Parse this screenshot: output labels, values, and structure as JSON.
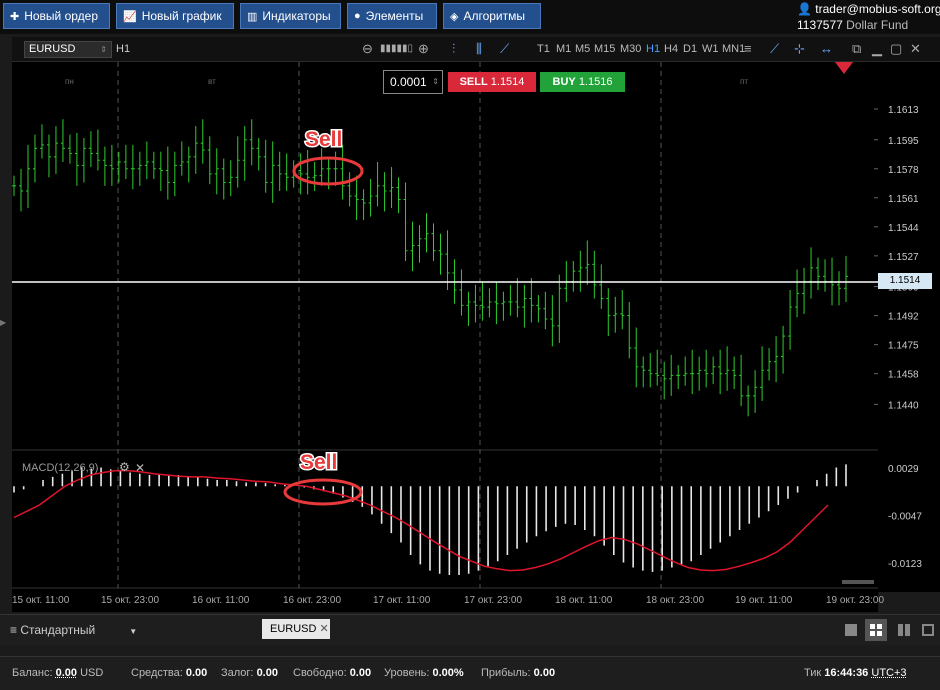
{
  "toolbar": {
    "new_order": "Новый ордер",
    "new_chart": "Новый график",
    "indicators": "Индикаторы",
    "elements": "Элементы",
    "algorithms": "Алгоритмы"
  },
  "account": {
    "user": "trader@mobius-soft.org",
    "id": "1137577",
    "fund": "Dollar Fund"
  },
  "chart_toolbar": {
    "symbol": "EURUSD",
    "period": "H1",
    "timeframes": [
      "T1",
      "M1",
      "M5",
      "M15",
      "M30",
      "H1",
      "H4",
      "D1",
      "W1",
      "MN1"
    ],
    "active_timeframe": "H1"
  },
  "trade": {
    "lot": "0.0001",
    "sell_label": "SELL",
    "sell_price": "1.1514",
    "buy_label": "BUY",
    "buy_price": "1.1516"
  },
  "day_labels": [
    "пн",
    "вт",
    "пт"
  ],
  "annotations": {
    "sell1": "Sell",
    "sell2": "Sell"
  },
  "indicator": {
    "label": "MACD(12,26,9)"
  },
  "colors": {
    "accent": "#4ba0ff",
    "sell": "#d9283a",
    "buy": "#21a33a",
    "candle_up": "#2ecc2e",
    "macd_hist": "#e8e8e8",
    "macd_signal": "#e0142a",
    "annotation": "#e83a3a"
  },
  "chart_data": {
    "type": "candlestick",
    "price_axis_ticks": [
      "1.1613",
      "1.1595",
      "1.1578",
      "1.1561",
      "1.1544",
      "1.1527",
      "1.1509",
      "1.1492",
      "1.1475",
      "1.1458",
      "1.1440"
    ],
    "current_price": "1.1514",
    "price_range": [
      1.1425,
      1.163
    ],
    "time_labels": [
      "15 окт. 11:00",
      "15 окт. 23:00",
      "16 окт. 11:00",
      "16 окт. 23:00",
      "17 окт. 11:00",
      "17 окт. 23:00",
      "18 окт. 11:00",
      "18 окт. 23:00",
      "19 окт. 11:00",
      "19 окт. 23:00"
    ],
    "closes": [
      1.1568,
      1.1565,
      1.1578,
      1.159,
      1.1592,
      1.1585,
      1.1593,
      1.159,
      1.1587,
      1.158,
      1.159,
      1.1587,
      1.1583,
      1.158,
      1.1578,
      1.1582,
      1.1578,
      1.1578,
      1.158,
      1.1582,
      1.1578,
      1.1577,
      1.157,
      1.158,
      1.1582,
      1.1585,
      1.1593,
      1.1589,
      1.1575,
      1.1578,
      1.157,
      1.1573,
      1.1583,
      1.1595,
      1.159,
      1.1585,
      1.157,
      1.158,
      1.1575,
      1.1573,
      1.1577,
      1.1575,
      1.1573,
      1.1574,
      1.1578,
      1.1578,
      1.1578,
      1.1568,
      1.1562,
      1.156,
      1.1558,
      1.1562,
      1.1568,
      1.1565,
      1.1567,
      1.156,
      1.153,
      1.1533,
      1.1537,
      1.154,
      1.153,
      1.1528,
      1.1517,
      1.1507,
      1.1498,
      1.15,
      1.1498,
      1.1497,
      1.15,
      1.1499,
      1.15,
      1.15,
      1.1497,
      1.1502,
      1.1498,
      1.1496,
      1.149,
      1.1486,
      1.1508,
      1.1512,
      1.1518,
      1.152,
      1.1522,
      1.151,
      1.1502,
      1.1492,
      1.1493,
      1.1492,
      1.1473,
      1.1462,
      1.146,
      1.1458,
      1.1457,
      1.1455,
      1.1457,
      1.1457,
      1.1458,
      1.1458,
      1.146,
      1.1458,
      1.1462,
      1.1458,
      1.146,
      1.1457,
      1.1445,
      1.1445,
      1.145,
      1.146,
      1.1465,
      1.1468,
      1.148,
      1.1497,
      1.1505,
      1.1512,
      1.152,
      1.1515,
      1.1512,
      1.151,
      1.1508,
      1.1515
    ],
    "macd_ticks": [
      "0.0029",
      "-0.0047",
      "-0.0123"
    ],
    "macd_range": [
      -0.015,
      0.005
    ],
    "macd_hist": [
      -0.001,
      -0.0005,
      0.0,
      0.001,
      0.0015,
      0.002,
      0.0025,
      0.003,
      0.0028,
      0.003,
      0.0027,
      0.0025,
      0.0022,
      0.002,
      0.0018,
      0.002,
      0.0018,
      0.0018,
      0.0015,
      0.0014,
      0.0012,
      0.001,
      0.001,
      0.0008,
      0.0006,
      0.0006,
      0.0005,
      0.0003,
      0.0002,
      0.0,
      -0.0002,
      -0.0005,
      -0.0008,
      -0.0012,
      -0.0018,
      -0.0025,
      -0.0033,
      -0.0045,
      -0.006,
      -0.0075,
      -0.009,
      -0.011,
      -0.0125,
      -0.0135,
      -0.014,
      -0.0142,
      -0.0142,
      -0.014,
      -0.0135,
      -0.0128,
      -0.012,
      -0.011,
      -0.01,
      -0.009,
      -0.008,
      -0.0072,
      -0.0065,
      -0.006,
      -0.0062,
      -0.007,
      -0.008,
      -0.0095,
      -0.011,
      -0.0122,
      -0.013,
      -0.0135,
      -0.0137,
      -0.0135,
      -0.013,
      -0.0125,
      -0.012,
      -0.011,
      -0.01,
      -0.009,
      -0.008,
      -0.007,
      -0.006,
      -0.005,
      -0.004,
      -0.003,
      -0.002,
      -0.001,
      0.0,
      0.001,
      0.002,
      0.003,
      0.0035
    ],
    "macd_signal": [
      -0.005,
      -0.004,
      -0.003,
      -0.0015,
      0.0,
      0.001,
      0.0018,
      0.0022,
      0.0025,
      0.0025,
      0.0023,
      0.002,
      0.0018,
      0.0016,
      0.0015,
      0.0015,
      0.0013,
      0.0012,
      0.001,
      0.0008,
      0.0007,
      0.0004,
      0.0002,
      0.0,
      -0.0005,
      -0.001,
      -0.0015,
      -0.0022,
      -0.003,
      -0.004,
      -0.005,
      -0.0062,
      -0.0075,
      -0.0088,
      -0.01,
      -0.0112,
      -0.012,
      -0.0128,
      -0.0132,
      -0.0135,
      -0.0134,
      -0.013,
      -0.0124,
      -0.0116,
      -0.0106,
      -0.0096,
      -0.0087,
      -0.0082,
      -0.0085,
      -0.0092,
      -0.0102,
      -0.0112,
      -0.0122,
      -0.013,
      -0.0134,
      -0.0135,
      -0.0133,
      -0.0128,
      -0.0122,
      -0.0115,
      -0.0105,
      -0.009,
      -0.007,
      -0.005,
      -0.003
    ]
  },
  "bottom_tabs": {
    "workspace": "Стандартный",
    "tab": "EURUSD"
  },
  "status": {
    "balance_label": "Баланс:",
    "balance_value": "0.00",
    "balance_currency": "USD",
    "equity_label": "Средства:",
    "equity_value": "0.00",
    "margin_label": "Залог:",
    "margin_value": "0.00",
    "free_label": "Свободно:",
    "free_value": "0.00",
    "level_label": "Уровень:",
    "level_value": "0.00%",
    "profit_label": "Прибыль:",
    "profit_value": "0.00",
    "tick_label": "Тик",
    "tick_value": "16:44:36",
    "tz_value": "UTC+3"
  }
}
